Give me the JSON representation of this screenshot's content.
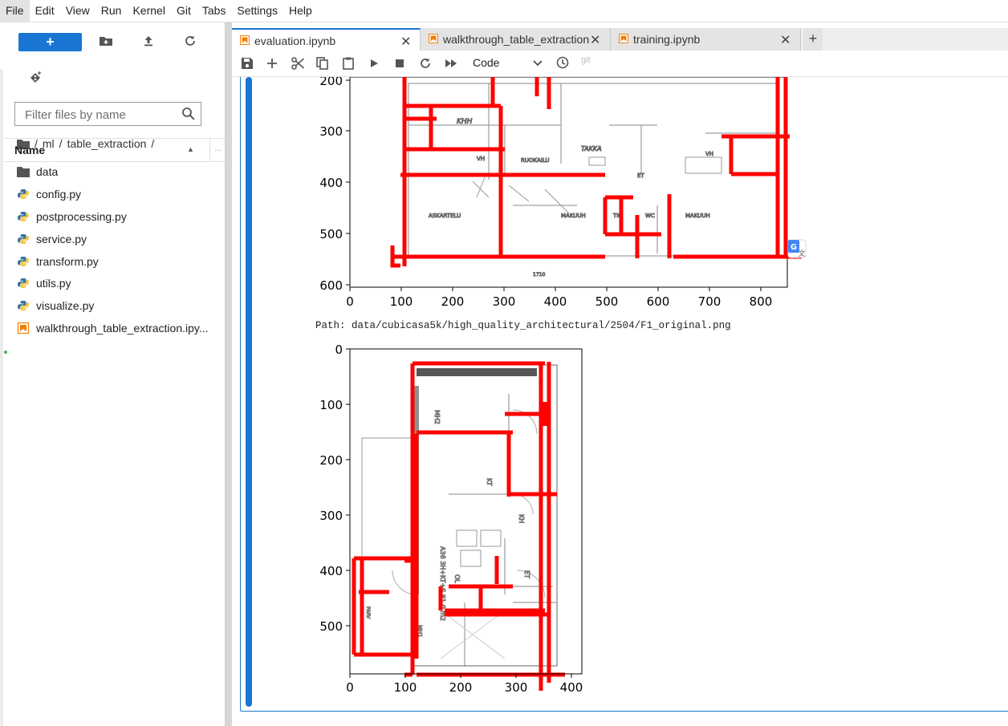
{
  "menu": [
    "File",
    "Edit",
    "View",
    "Run",
    "Kernel",
    "Git",
    "Tabs",
    "Settings",
    "Help"
  ],
  "sidebar": {
    "new_label": "+",
    "filter_placeholder": "Filter files by name",
    "breadcrumb": [
      "ml",
      "table_extraction"
    ],
    "column_header": "Name",
    "files": [
      {
        "name": "data",
        "type": "folder"
      },
      {
        "name": "config.py",
        "type": "python"
      },
      {
        "name": "postprocessing.py",
        "type": "python"
      },
      {
        "name": "service.py",
        "type": "python"
      },
      {
        "name": "transform.py",
        "type": "python"
      },
      {
        "name": "utils.py",
        "type": "python"
      },
      {
        "name": "visualize.py",
        "type": "python"
      },
      {
        "name": "walkthrough_table_extraction.ipy...",
        "type": "notebook",
        "running": true
      }
    ]
  },
  "tabs": [
    {
      "label": "evaluation.ipynb",
      "active": true
    },
    {
      "label": "walkthrough_table_extraction",
      "active": false
    },
    {
      "label": "training.ipynb",
      "active": false
    }
  ],
  "toolbar": {
    "cell_type": "Code",
    "git_label": "git"
  },
  "output": {
    "path_text": "Path: data/cubicasa5k/high_quality_architectural/2504/F1_original.png",
    "plot1": {
      "y_ticks": [
        "200",
        "300",
        "400",
        "500",
        "600"
      ],
      "x_ticks": [
        "0",
        "100",
        "200",
        "300",
        "400",
        "500",
        "600",
        "700",
        "800"
      ]
    },
    "plot2": {
      "y_ticks": [
        "0",
        "100",
        "200",
        "300",
        "400",
        "500"
      ],
      "x_ticks": [
        "0",
        "100",
        "200",
        "300",
        "400"
      ]
    }
  },
  "colors": {
    "accent": "#1976d2",
    "overlay": "#ff0000",
    "notebook_icon": "#f57c00",
    "python_icon": "#3572a5"
  }
}
